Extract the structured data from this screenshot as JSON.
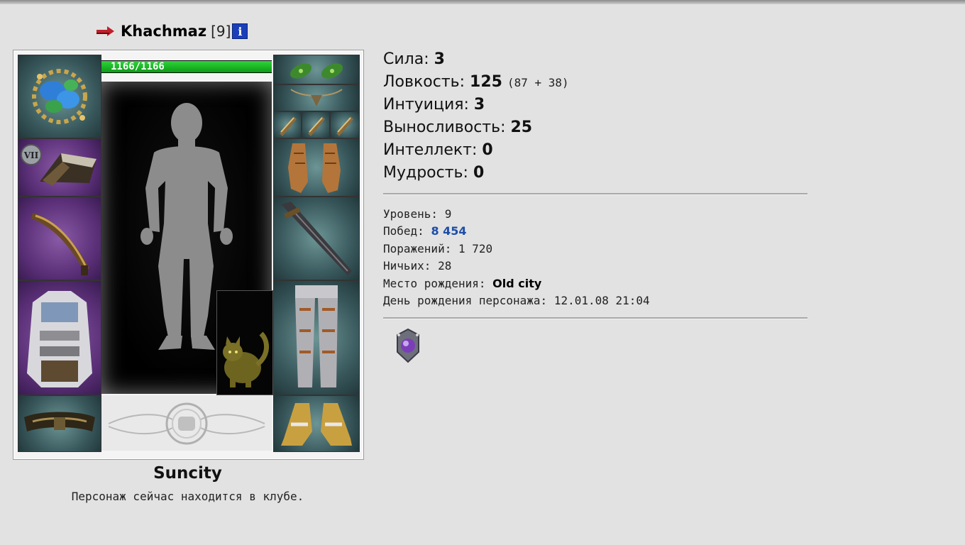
{
  "character": {
    "name": "Khachmaz",
    "level": "[9]",
    "info_glyph": "i",
    "hp_text": "1166/1166",
    "hp_fraction": 1.0
  },
  "equipment": {
    "left_slots": [
      "amulet-ring-icon",
      "bracers-icon",
      "dagger-icon",
      "armor-icon",
      "belt-icon"
    ],
    "right_slots": [
      "earrings-icon",
      "necklace-icon",
      "ring-icon",
      "gloves-icon",
      "sword-icon",
      "leggings-icon",
      "boots-icon"
    ],
    "left_badge": "VII",
    "pet": "cat-pet-icon"
  },
  "city": {
    "name": "Suncity",
    "status": "Персонаж сейчас находится в клубе."
  },
  "stats": [
    {
      "label": "Сила:",
      "value": "3",
      "extra": ""
    },
    {
      "label": "Ловкость:",
      "value": "125",
      "extra": "(87 + 38)"
    },
    {
      "label": "Интуиция:",
      "value": "3",
      "extra": ""
    },
    {
      "label": "Выносливость:",
      "value": "25",
      "extra": ""
    },
    {
      "label": "Интеллект:",
      "value": "0",
      "extra": ""
    },
    {
      "label": "Мудрость:",
      "value": "0",
      "extra": ""
    }
  ],
  "info": {
    "level_label": "Уровень:",
    "level_value": "9",
    "wins_label": "Побед:",
    "wins_value": "8 454",
    "losses_label": "Поражений:",
    "losses_value": "1 720",
    "draws_label": "Ничьих:",
    "draws_value": "28",
    "birthplace_label": "Место рождения:",
    "birthplace_value": "Old city",
    "birthday_label": "День рождения персонажа:",
    "birthday_value": "12.01.08 21:04"
  },
  "colors": {
    "background": "#e2e2e2",
    "hp_green": "#1fb82a",
    "info_blue": "#1a3fb8",
    "wins_blue": "#1c4ea6",
    "arrow_red": "#c0202a"
  }
}
